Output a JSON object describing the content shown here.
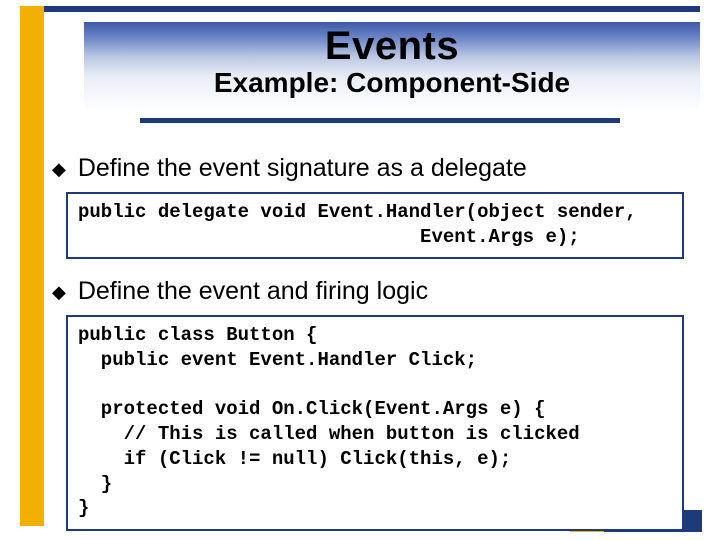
{
  "header": {
    "title": "Events",
    "subtitle": "Example: Component-Side"
  },
  "bullets": [
    "Define the event signature as a delegate",
    "Define the event and firing logic"
  ],
  "code": {
    "block1": "public delegate void Event.Handler(object sender,\n                              Event.Args e);",
    "block2": "public class Button {\n  public event Event.Handler Click;\n\n  protected void On.Click(Event.Args e) {\n    // This is called when button is clicked\n    if (Click != null) Click(this, e);\n  }\n}"
  }
}
